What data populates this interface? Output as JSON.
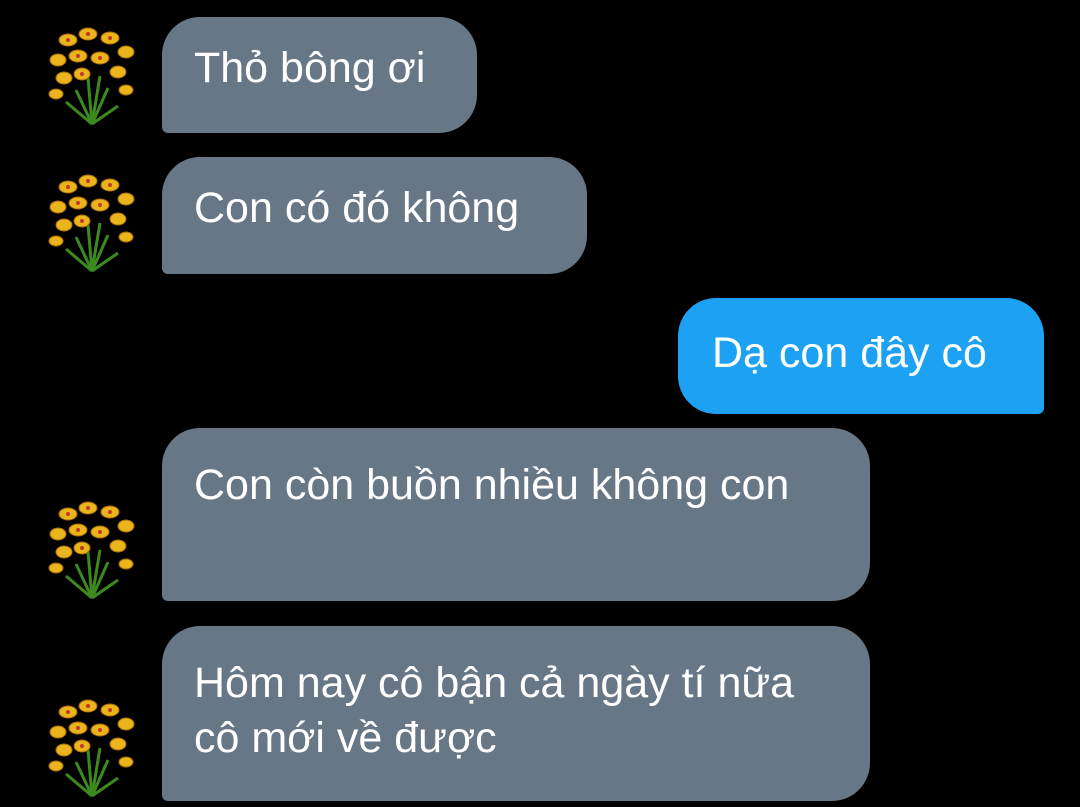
{
  "conversation": {
    "messages": [
      {
        "sender": "contact",
        "text": "Thỏ bông ơi",
        "avatar": "yellow-orchid-flower"
      },
      {
        "sender": "contact",
        "text": "Con có đó không",
        "avatar": "yellow-orchid-flower"
      },
      {
        "sender": "me",
        "text": "Dạ con đây cô"
      },
      {
        "sender": "contact",
        "text": "Con còn buồn nhiều không con",
        "avatar": "yellow-orchid-flower"
      },
      {
        "sender": "contact",
        "text": "Hôm nay cô bận cả ngày tí nữa cô mới về được",
        "avatar": "yellow-orchid-flower"
      }
    ]
  },
  "colors": {
    "background": "#000000",
    "incoming_bubble": "#677786",
    "outgoing_bubble": "#1da1f2",
    "text": "#ffffff"
  }
}
